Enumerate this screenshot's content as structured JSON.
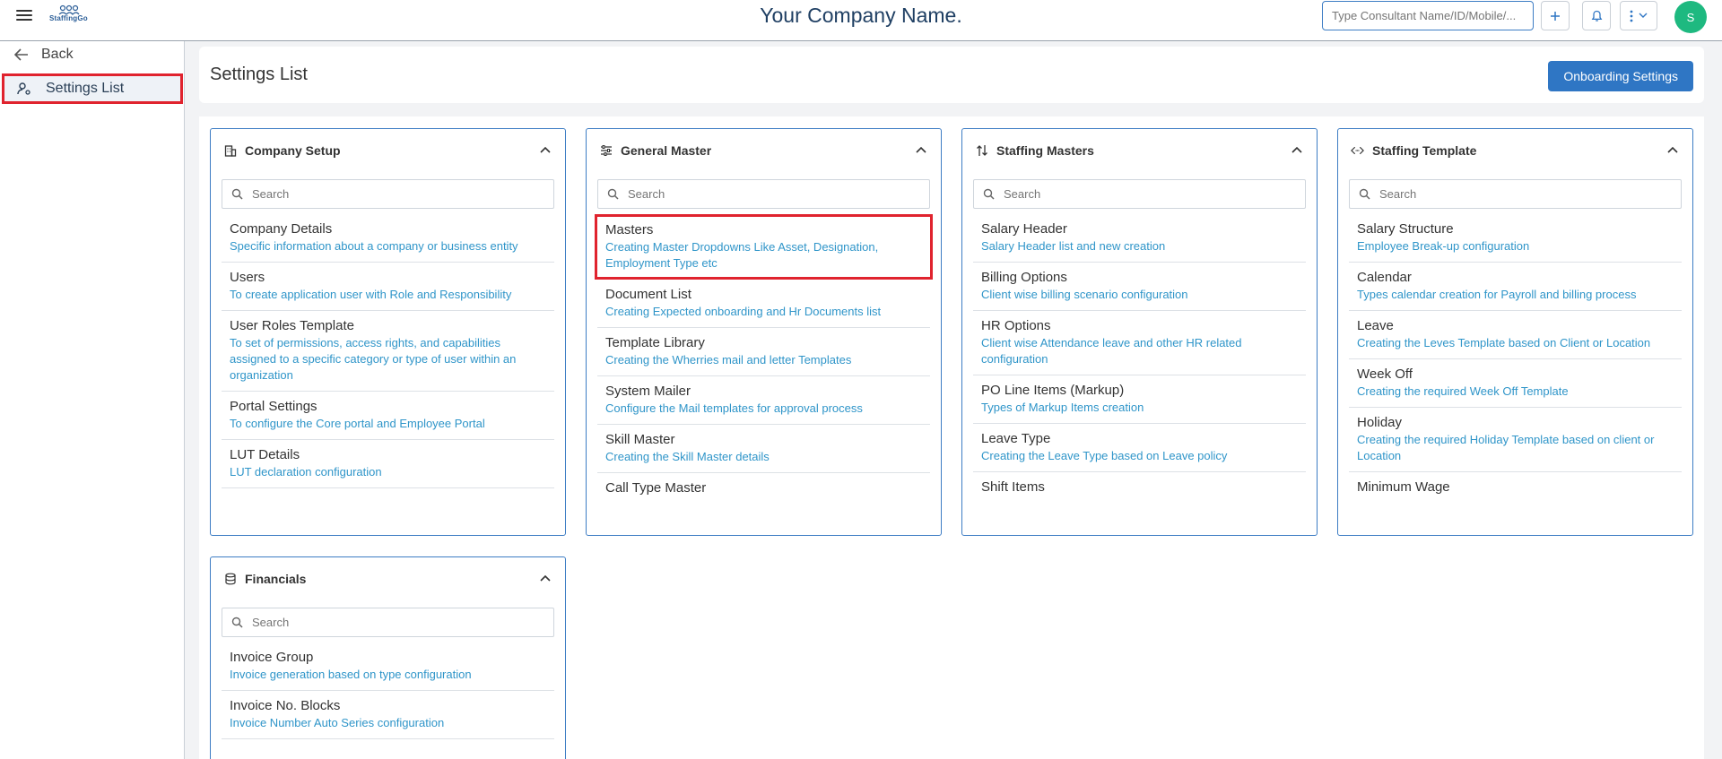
{
  "app": {
    "company_name": "Your Company Name.",
    "logo_text": "StaffingGo",
    "search_placeholder": "Type Consultant Name/ID/Mobile/...",
    "avatar_initial": "S"
  },
  "sidebar": {
    "back_label": "Back",
    "settings_label": "Settings List"
  },
  "page": {
    "title": "Settings List",
    "onboarding_button": "Onboarding Settings"
  },
  "search_placeholder": "Search",
  "cards": {
    "company_setup": {
      "title": "Company Setup",
      "icon": "building-icon",
      "items": [
        {
          "title": "Company Details",
          "desc": "Specific information about a company or business entity"
        },
        {
          "title": "Users",
          "desc": "To create application user with Role and Responsibility"
        },
        {
          "title": "User Roles Template",
          "desc": "To set of permissions, access rights, and capabilities assigned to a specific category or type of user within an organization"
        },
        {
          "title": "Portal Settings",
          "desc": "To configure the Core portal and Employee Portal"
        },
        {
          "title": "LUT Details",
          "desc": "LUT declaration configuration"
        }
      ]
    },
    "general_master": {
      "title": "General Master",
      "icon": "sliders-icon",
      "items": [
        {
          "title": "Masters",
          "desc": "Creating Master Dropdowns Like Asset, Designation, Employment Type etc"
        },
        {
          "title": "Document List",
          "desc": "Creating Expected onboarding and Hr Documents list"
        },
        {
          "title": "Template Library",
          "desc": "Creating the Wherries mail and letter Templates"
        },
        {
          "title": "System Mailer",
          "desc": "Configure the Mail templates for approval process"
        },
        {
          "title": "Skill Master",
          "desc": "Creating the Skill Master details"
        },
        {
          "title": "Call Type Master",
          "desc": ""
        }
      ]
    },
    "staffing_masters": {
      "title": "Staffing Masters",
      "icon": "sort-icon",
      "items": [
        {
          "title": "Salary Header",
          "desc": "Salary Header list and new creation"
        },
        {
          "title": "Billing Options",
          "desc": "Client wise billing scenario configuration"
        },
        {
          "title": "HR Options",
          "desc": "Client wise Attendance leave and other HR related configuration"
        },
        {
          "title": "PO Line Items (Markup)",
          "desc": "Types of Markup Items creation"
        },
        {
          "title": "Leave Type",
          "desc": "Creating the Leave Type based on Leave policy"
        },
        {
          "title": "Shift Items",
          "desc": ""
        }
      ]
    },
    "staffing_template": {
      "title": "Staffing Template",
      "icon": "code-icon",
      "items": [
        {
          "title": "Salary Structure",
          "desc": "Employee Break-up configuration"
        },
        {
          "title": "Calendar",
          "desc": "Types calendar creation for Payroll and billing process"
        },
        {
          "title": "Leave",
          "desc": "Creating the Leves Template based on Client or Location"
        },
        {
          "title": "Week Off",
          "desc": "Creating the required Week Off Template"
        },
        {
          "title": "Holiday",
          "desc": "Creating the required Holiday Template based on client or Location"
        },
        {
          "title": "Minimum Wage",
          "desc": ""
        }
      ]
    },
    "financials": {
      "title": "Financials",
      "icon": "database-icon",
      "items": [
        {
          "title": "Invoice Group",
          "desc": "Invoice generation based on type configuration"
        },
        {
          "title": "Invoice No. Blocks",
          "desc": "Invoice Number Auto Series configuration"
        }
      ]
    }
  },
  "colors": {
    "accent": "#2f76c4",
    "highlight_red": "#e0232e",
    "link_blue": "#2f95c9",
    "avatar_green": "#1eb980",
    "title_navy": "#1f3f63"
  }
}
